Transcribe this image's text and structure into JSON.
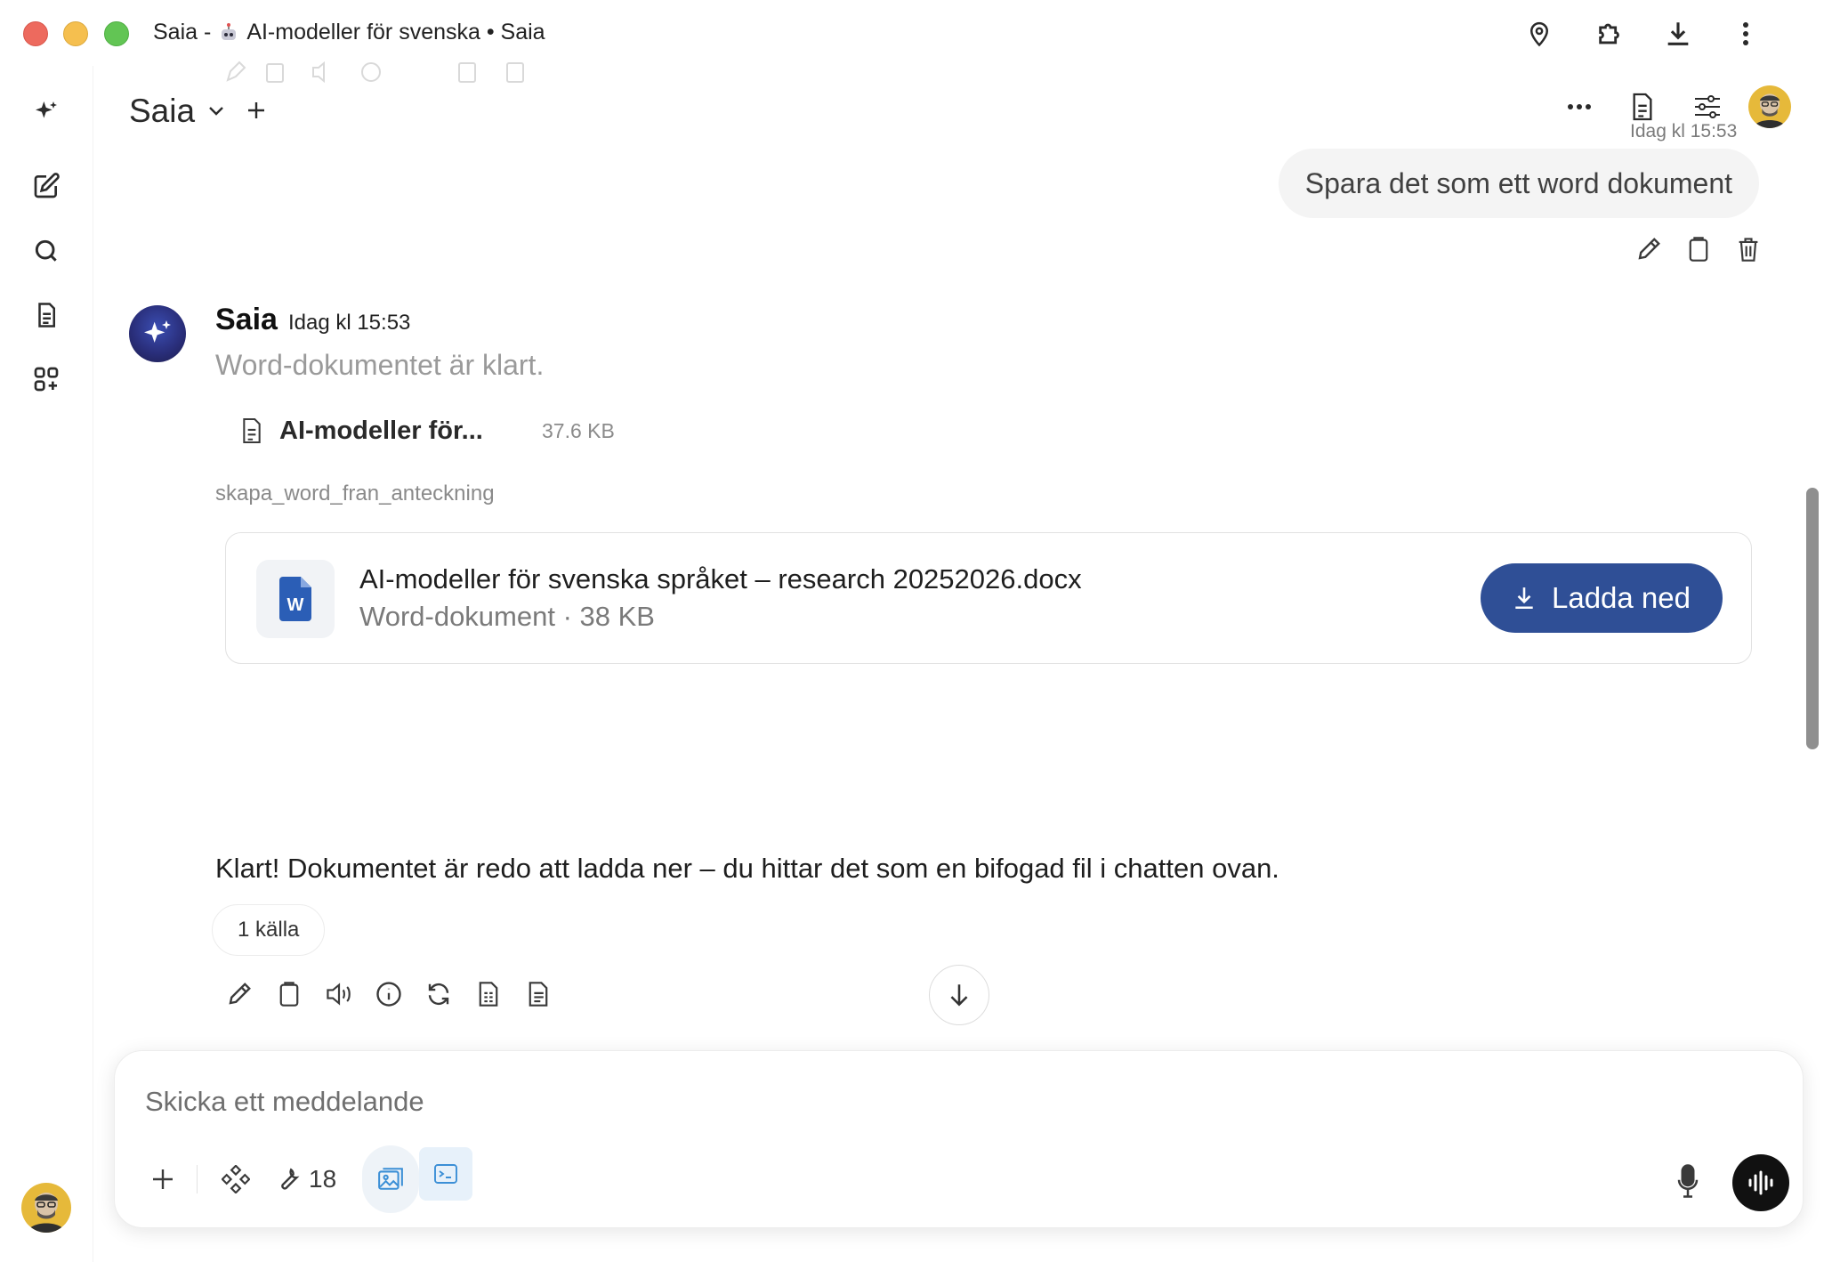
{
  "window": {
    "title_prefix": "Saia -",
    "title_main": "AI-modeller för svenska • Saia"
  },
  "header": {
    "model_name": "Saia",
    "user_time": "Idag kl 15:53"
  },
  "user_message": {
    "text": "Spara det som ett word dokument"
  },
  "assistant": {
    "name": "Saia",
    "time": "Idag kl 15:53",
    "status": "Word-dokumentet är klart.",
    "file_chip": {
      "name": "AI-modeller för...",
      "size": "37.6 KB"
    },
    "tool_name": "skapa_word_fran_anteckning",
    "document": {
      "icon_letter": "W",
      "title": "AI-modeller för svenska språket – research 20252026.docx",
      "meta": "Word-dokument · 38 KB",
      "download_label": "Ladda ned"
    },
    "reply": "Klart! Dokumentet är redo att ladda ner – du hittar det som en bifogad fil i chatten ovan.",
    "sources_label": "1 källa"
  },
  "composer": {
    "placeholder": "Skicka ett meddelande",
    "tools_count": "18"
  },
  "colors": {
    "accent_button": "#2f4f96",
    "word_blue": "#2b5eb6",
    "voice_button": "#111111",
    "user_bubble": "#f4f4f4"
  }
}
